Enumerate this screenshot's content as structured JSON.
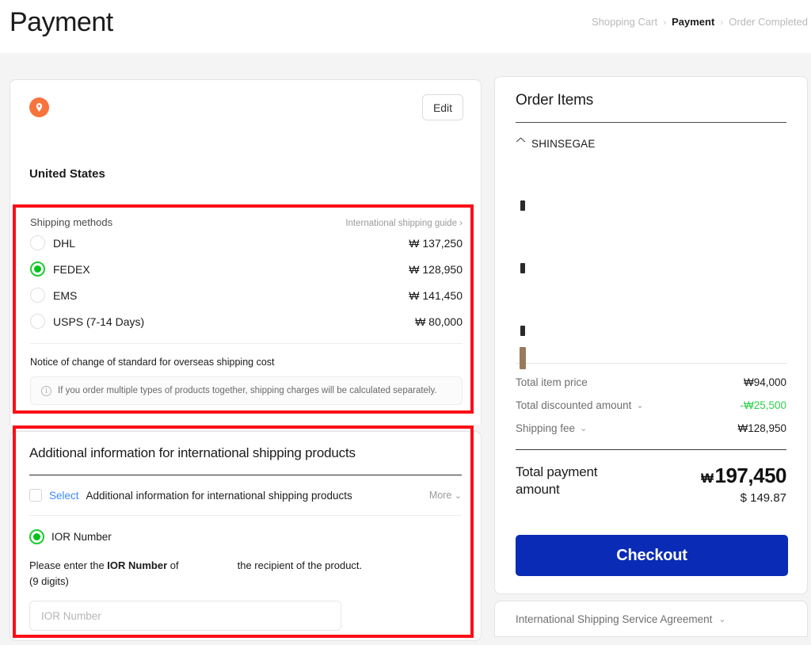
{
  "header": {
    "title": "Payment",
    "breadcrumb": [
      {
        "label": "Shopping Cart",
        "active": false
      },
      {
        "label": "Payment",
        "active": true
      },
      {
        "label": "Order Completed",
        "active": false
      }
    ],
    "separator": "›"
  },
  "address": {
    "pin_icon": "location-pin-icon",
    "edit_label": "Edit",
    "country": "United States"
  },
  "shipping": {
    "section_label": "Shipping methods",
    "guide_link": "International shipping guide ›",
    "methods": [
      {
        "name": "DHL",
        "price": "₩ 137,250",
        "selected": false
      },
      {
        "name": "FEDEX",
        "price": "₩ 128,950",
        "selected": true
      },
      {
        "name": "EMS",
        "price": "₩ 141,450",
        "selected": false
      },
      {
        "name": "USPS (7-14 Days)",
        "price": "₩ 80,000",
        "selected": false
      }
    ],
    "notice_title": "Notice of change of standard for overseas shipping cost",
    "notice_icon": "info-icon",
    "notice_text": "If you order multiple types of products together, shipping charges will be calculated separately."
  },
  "additional": {
    "title": "Additional information for international shipping products",
    "select_link": "Select",
    "select_text": "Additional information for international shipping products",
    "more_label": "More",
    "more_chevron": "⌄",
    "ior_option_label": "IOR Number",
    "ior_option_selected": true,
    "desc_prefix": "Please enter the ",
    "desc_bold": "IOR Number",
    "desc_mid": " of",
    "desc_suffix": "the recipient of the product.",
    "desc_line2": "(9 digits)",
    "ior_input_value": "",
    "ior_input_placeholder": "IOR Number"
  },
  "order_summary": {
    "title": "Order Items",
    "merchant_icon": "store-home-icon",
    "merchant": "SHINSEGAE",
    "totals": [
      {
        "label": "Total item price",
        "value": "₩94,000",
        "chevron": "",
        "discount": false
      },
      {
        "label": "Total discounted amount",
        "value": "-₩25,500",
        "chevron": "⌄",
        "discount": true
      },
      {
        "label": "Shipping fee",
        "value": "₩128,950",
        "chevron": "⌄",
        "discount": false
      }
    ],
    "grand_label": "Total payment amount",
    "grand_symbol": "₩",
    "grand_krw": "197,450",
    "grand_usd": "$ 149.87",
    "checkout_label": "Checkout"
  },
  "agreement": {
    "label": "International Shipping Service Agreement",
    "chevron": "⌄"
  },
  "colors": {
    "accent_orange": "#f8743c",
    "radio_green": "#00c21b",
    "discount_green": "#2ed04a",
    "checkout_blue": "#0a2bb5",
    "link_blue": "#3d8bfd",
    "annotation_red": "#fb0f18",
    "page_bg": "#f4f4f4"
  }
}
